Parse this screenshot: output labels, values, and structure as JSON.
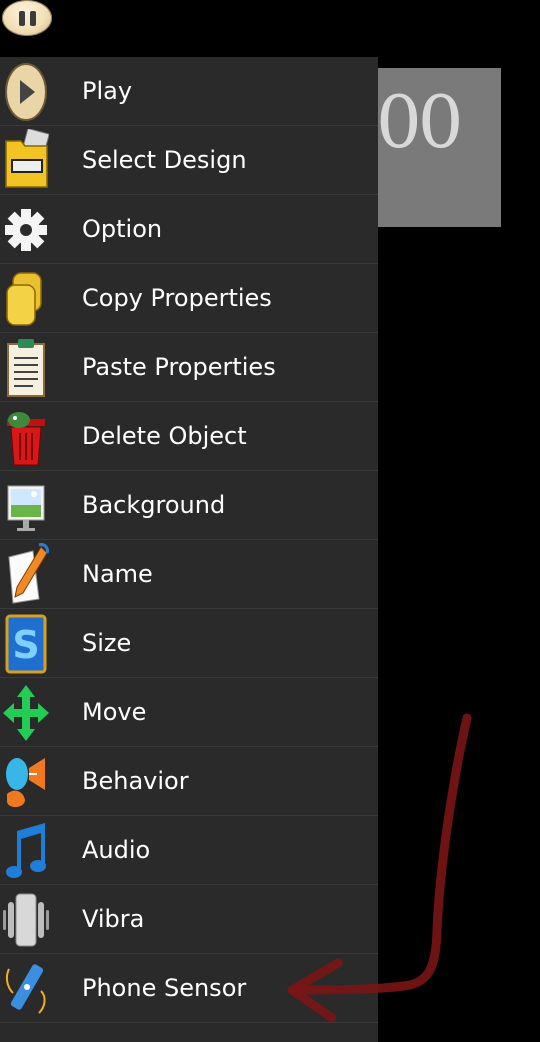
{
  "status": {
    "number_display": "00"
  },
  "menu": {
    "items": [
      {
        "label": "Play",
        "icon": "play-icon"
      },
      {
        "label": "Select Design",
        "icon": "folder-icon"
      },
      {
        "label": "Option",
        "icon": "gear-icon"
      },
      {
        "label": "Copy Properties",
        "icon": "copy-icon"
      },
      {
        "label": "Paste Properties",
        "icon": "clipboard-icon"
      },
      {
        "label": "Delete Object",
        "icon": "trash-icon"
      },
      {
        "label": "Background",
        "icon": "landscape-icon"
      },
      {
        "label": "Name",
        "icon": "pencil-icon"
      },
      {
        "label": "Size",
        "icon": "size-icon"
      },
      {
        "label": "Move",
        "icon": "move-arrows-icon"
      },
      {
        "label": "Behavior",
        "icon": "behavior-icon"
      },
      {
        "label": "Audio",
        "icon": "music-note-icon"
      },
      {
        "label": "Vibra",
        "icon": "vibration-icon"
      },
      {
        "label": "Phone Sensor",
        "icon": "sensor-icon"
      }
    ]
  },
  "colors": {
    "menu_bg": "#2a2a2a",
    "annotation": "#7a1515"
  }
}
